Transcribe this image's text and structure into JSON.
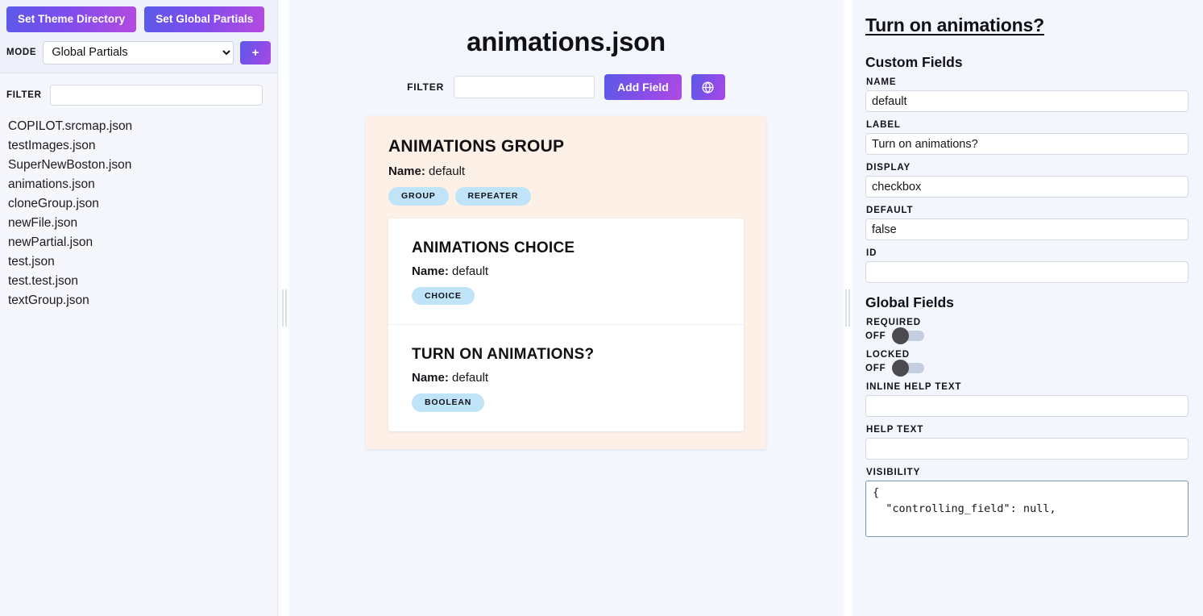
{
  "sidebar": {
    "set_theme_directory_label": "Set Theme Directory",
    "set_global_partials_label": "Set Global Partials",
    "mode_label": "MODE",
    "mode_value": "Global Partials",
    "mode_options": [
      "Global Partials"
    ],
    "add_button_label": "+",
    "filter_label": "FILTER",
    "filter_value": "",
    "filter_placeholder": "",
    "files": [
      "COPILOT.srcmap.json",
      "testImages.json",
      "SuperNewBoston.json",
      "animations.json",
      "cloneGroup.json",
      "newFile.json",
      "newPartial.json",
      "test.json",
      "test.test.json",
      "textGroup.json"
    ]
  },
  "center": {
    "title": "animations.json",
    "filter_label": "FILTER",
    "filter_value": "",
    "filter_placeholder": "",
    "add_field_label": "Add Field",
    "globe_icon": "globe-icon",
    "group": {
      "title": "ANIMATIONS GROUP",
      "name_label": "Name:",
      "name_value": "default",
      "tags": [
        "GROUP",
        "REPEATER"
      ],
      "children": [
        {
          "title": "ANIMATIONS CHOICE",
          "name_label": "Name:",
          "name_value": "default",
          "tags": [
            "CHOICE"
          ]
        },
        {
          "title": "TURN ON ANIMATIONS?",
          "name_label": "Name:",
          "name_value": "default",
          "tags": [
            "BOOLEAN"
          ]
        }
      ]
    }
  },
  "right": {
    "title": "Turn on animations?",
    "custom_fields_heading": "Custom Fields",
    "global_fields_heading": "Global Fields",
    "name_label": "NAME",
    "name_value": "default",
    "label_label": "LABEL",
    "label_value": "Turn on animations?",
    "display_label": "DISPLAY",
    "display_value": "checkbox",
    "default_label": "DEFAULT",
    "default_value": "false",
    "id_label": "ID",
    "id_value": "",
    "required_label": "REQUIRED",
    "required_state": "OFF",
    "locked_label": "LOCKED",
    "locked_state": "OFF",
    "inline_help_label": "INLINE HELP TEXT",
    "inline_help_value": "",
    "help_text_label": "HELP TEXT",
    "help_text_value": "",
    "visibility_label": "VISIBILITY",
    "visibility_value": "{\n  \"controlling_field\": null,\n"
  },
  "colors": {
    "accent_gradient_start": "#5b5ae8",
    "accent_gradient_end": "#b44ae0",
    "tag_bg": "#bfe4f8",
    "group_card_bg": "#fdf1e7",
    "panel_bg": "#f4f6fd",
    "sidebar_bg": "#f5f7fd"
  }
}
